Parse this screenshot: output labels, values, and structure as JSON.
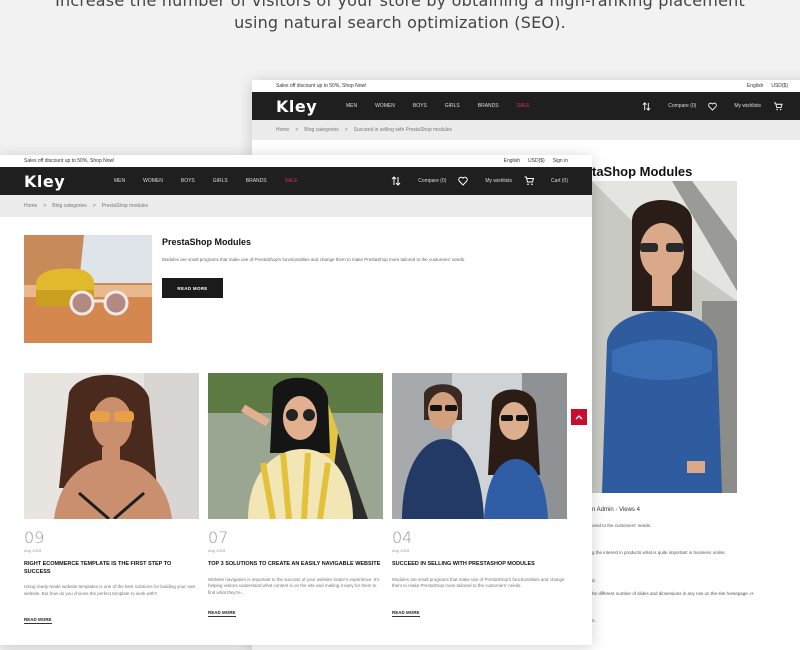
{
  "promo": {
    "line1": "Increase the number of visitors of your store by obtaining a high-ranking placement",
    "line2": "using natural search optimization (SEO)."
  },
  "back": {
    "topbar": {
      "promo": "Sales off discount up to 50%, Shop Now!",
      "lang": "English",
      "currency": "USD($)"
    },
    "logo": "Kley",
    "menu": [
      "MEN",
      "WOMEN",
      "BOYS",
      "GIRLS",
      "BRANDS",
      "SALE"
    ],
    "tools": {
      "compare": "Compare (0)",
      "wishlist": "My wishlists"
    },
    "breadcrumb": [
      "Home",
      "Blog categories",
      "Succeed in selling with PrestaShop modules"
    ],
    "title": "taShop Modules",
    "meta_prefix": "n Admin - Views",
    "views": "4",
    "lines": [
      "ored to the customers' needs.",
      "g the interest in products what is quite important in business online.",
      "d.",
      "he different number of slides and dimensions in any row on the site homepage. H",
      "n."
    ]
  },
  "front": {
    "topbar": {
      "promo": "Sales off discount up to 50%, Shop Now!",
      "lang": "English",
      "currency": "USD($)",
      "signin": "Sign in"
    },
    "logo": "Kley",
    "menu": [
      "MEN",
      "WOMEN",
      "BOYS",
      "GIRLS",
      "BRANDS",
      "SALE"
    ],
    "tools": {
      "compare": "Compare (0)",
      "wishlist": "My wishlists",
      "cart": "Cart (0)"
    },
    "breadcrumb": [
      "Home",
      "Blog categories",
      "PrestaShop modules"
    ],
    "featured": {
      "title": "PrestaShop Modules",
      "desc": "Modules are small programs that make use of PrestaShop's functionalities and change them to make PrestaShop more tailored to the customers' needs.",
      "button": "READ MORE"
    },
    "posts": [
      {
        "day": "09",
        "date": "Aug 2018",
        "title": "RIGHT ECOMMERCE TEMPLATE IS THE FIRST STEP TO SUCCESS",
        "desc": "Using ready-made website templates is one of the best solutions for building your own website. But how do you choose the perfect template to work with?",
        "more": "READ MORE"
      },
      {
        "day": "07",
        "date": "Aug 2018",
        "title": "TOP 3 SOLUTIONS TO CREATE AN EASILY NAVIGABLE WEBSITE",
        "desc": "Website navigation is important to the success of your website visitor's experience. It's helping visitors understand what content is on the site and making it easy for them to find what they're...",
        "more": "READ MORE"
      },
      {
        "day": "04",
        "date": "Aug 2018",
        "title": "SUCCEED IN SELLING WITH PRESTASHOP MODULES",
        "desc": "Modules are small programs that make use of PrestaShop's functionalities and change them to make PrestaShop more tailored to the customers' needs.",
        "more": "READ MORE"
      }
    ]
  },
  "colors": {
    "nav_bg": "#1f1f1f",
    "sale": "#e0304a",
    "accent": "#c8102e"
  }
}
